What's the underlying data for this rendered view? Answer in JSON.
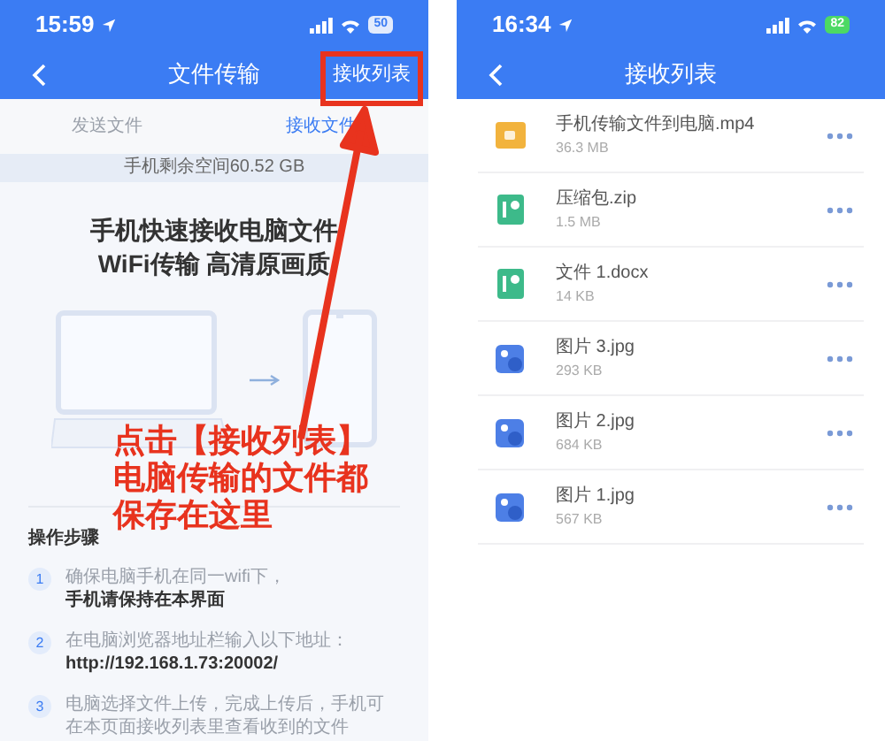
{
  "left_screen": {
    "status_bar": {
      "time": "15:59",
      "battery": "50",
      "charging": false
    },
    "nav": {
      "title": "文件传输",
      "action": "接收列表"
    },
    "tabs": [
      {
        "label": "发送文件",
        "selected": false
      },
      {
        "label": "接收文件",
        "selected": true
      }
    ],
    "storage": "手机剩余空间60.52 GB",
    "headline": [
      "手机快速接收电脑文件",
      "WiFi传输 高清原画质"
    ],
    "steps_title": "操作步骤",
    "steps": [
      {
        "number": "1",
        "text": "确保电脑手机在同一wifi下，",
        "detail": "手机请保持在本界面"
      },
      {
        "number": "2",
        "text": "在电脑浏览器地址栏输入以下地址：",
        "detail": "http://192.168.1.73:20002/"
      },
      {
        "number": "3",
        "text": "电脑选择文件上传，完成上传后，手机可在本页面接收列表里查看收到的文件"
      }
    ]
  },
  "annotation": {
    "lines": [
      "点击【接收列表】",
      "电脑传输的文件都",
      "保存在这里"
    ]
  },
  "right_screen": {
    "status_bar": {
      "time": "16:34",
      "battery": "82",
      "charging": true
    },
    "nav": {
      "title": "接收列表"
    },
    "files": [
      {
        "kind": "video",
        "name": "手机传输文件到电脑.mp4",
        "size": "36.3 MB"
      },
      {
        "kind": "archive",
        "name": "压缩包.zip",
        "size": "1.5 MB"
      },
      {
        "kind": "document",
        "name": "文件 1.docx",
        "size": "14 KB"
      },
      {
        "kind": "image",
        "name": "图片 3.jpg",
        "size": "293 KB"
      },
      {
        "kind": "image",
        "name": "图片 2.jpg",
        "size": "684 KB"
      },
      {
        "kind": "image",
        "name": "图片 1.jpg",
        "size": "567 KB"
      }
    ]
  }
}
